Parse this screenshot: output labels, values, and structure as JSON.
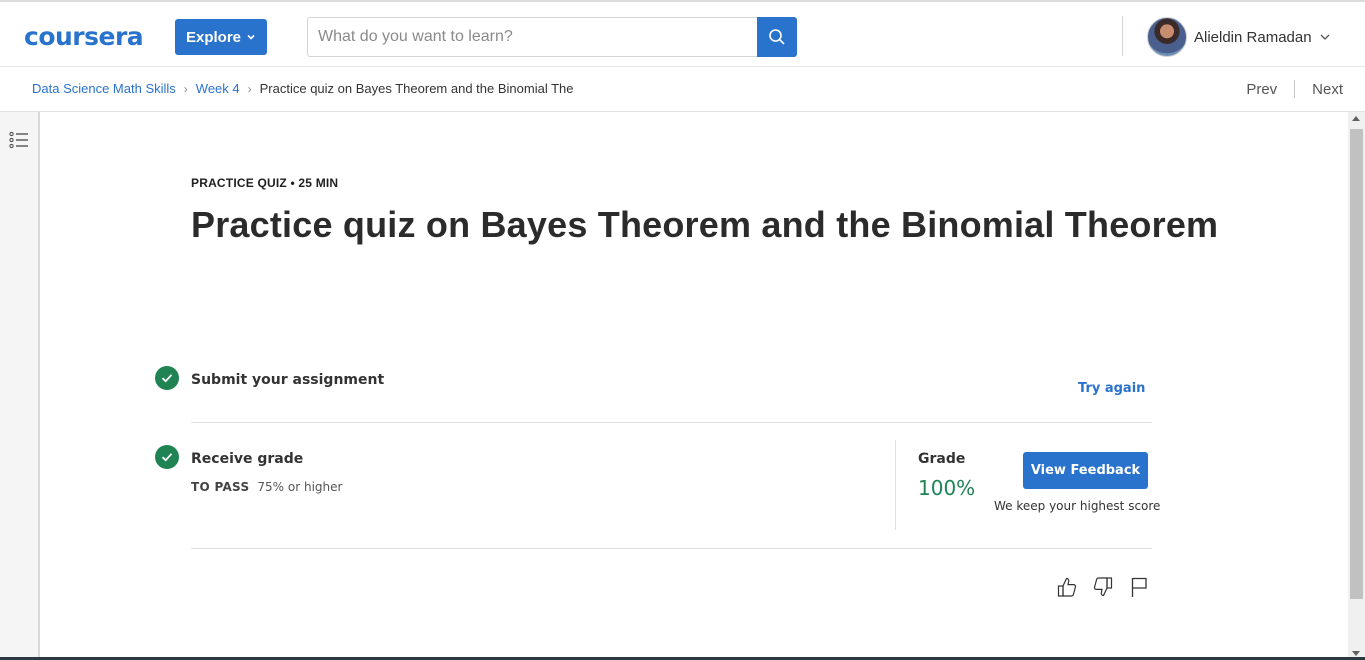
{
  "header": {
    "logo_text": "coursera",
    "explore_label": "Explore",
    "search_placeholder": "What do you want to learn?",
    "user_name": "Alieldin Ramadan"
  },
  "breadcrumb": {
    "items": [
      "Data Science Math Skills",
      "Week 4"
    ],
    "current": "Practice quiz on Bayes Theorem and the Binomial The",
    "prev_label": "Prev",
    "next_label": "Next"
  },
  "quiz": {
    "kicker_type": "PRACTICE QUIZ",
    "kicker_duration": "25 MIN",
    "title": "Practice quiz on Bayes Theorem and the Binomial Theorem"
  },
  "steps": {
    "submit_title": "Submit your assignment",
    "try_again_label": "Try again",
    "receive_title": "Receive grade",
    "to_pass_label": "TO PASS",
    "to_pass_value": "75% or higher",
    "grade_label": "Grade",
    "grade_value": "100%",
    "view_feedback_label": "View Feedback",
    "highest_score_note": "We keep your highest score"
  },
  "colors": {
    "brand_blue": "#2a73cc",
    "success_green": "#1f8354"
  },
  "icons": {
    "toc": "list-icon",
    "search": "search-icon",
    "like": "thumbs-up-icon",
    "dislike": "thumbs-down-icon",
    "flag": "flag-icon"
  }
}
